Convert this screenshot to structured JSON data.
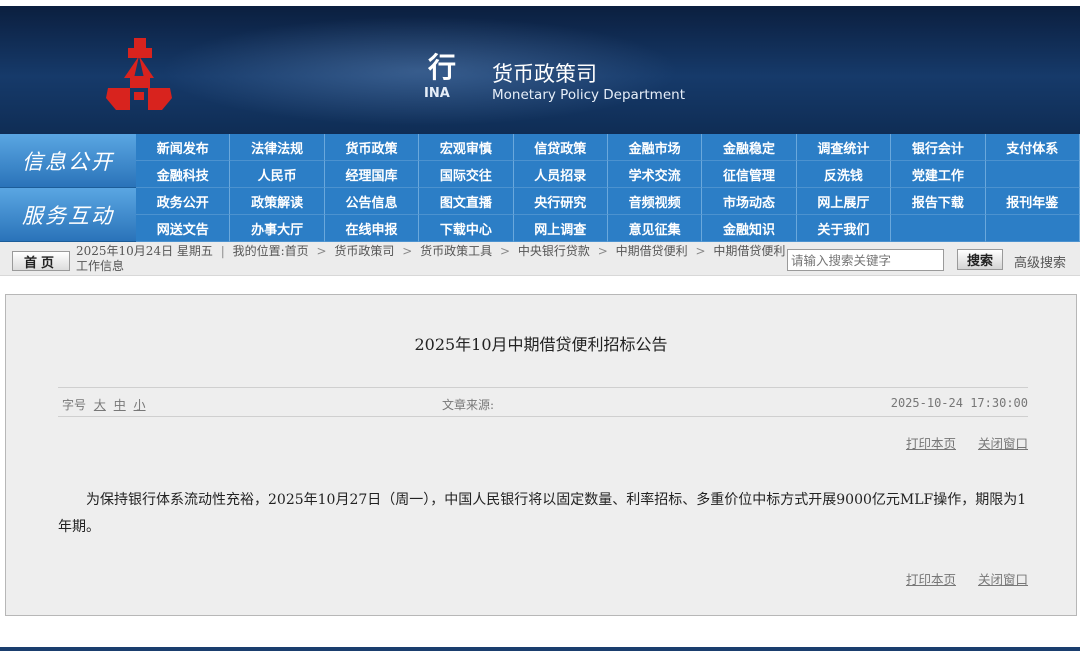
{
  "header": {
    "bank_char": "行",
    "bank_en": "INA",
    "dept_cn": "货币政策司",
    "dept_en": "Monetary Policy Department"
  },
  "nav": {
    "label_1": "信息公开",
    "label_2": "服务互动",
    "rows": [
      [
        "新闻发布",
        "法律法规",
        "货币政策",
        "宏观审慎",
        "信贷政策",
        "金融市场",
        "金融稳定",
        "调查统计",
        "银行会计",
        "支付体系"
      ],
      [
        "金融科技",
        "人民币",
        "经理国库",
        "国际交往",
        "人员招录",
        "学术交流",
        "征信管理",
        "反洗钱",
        "党建工作",
        ""
      ],
      [
        "政务公开",
        "政策解读",
        "公告信息",
        "图文直播",
        "央行研究",
        "音频视频",
        "市场动态",
        "网上展厅",
        "报告下载",
        "报刊年鉴"
      ],
      [
        "网送文告",
        "办事大厅",
        "在线申报",
        "下载中心",
        "网上调查",
        "意见征集",
        "金融知识",
        "关于我们",
        "",
        ""
      ]
    ]
  },
  "bar": {
    "home": "首页",
    "date": "2025年10月24日 星期五",
    "location_label": "我的位置:",
    "crumbs": [
      "首页",
      "货币政策司",
      "货币政策工具",
      "中央银行贷款",
      "中期借贷便利",
      "中期借贷便利工作信息"
    ],
    "search_placeholder": "请输入搜索关键字",
    "search_btn": "搜索",
    "advanced": "高级搜索"
  },
  "article": {
    "title": "2025年10月中期借贷便利招标公告",
    "font_label": "字号",
    "font_large": "大",
    "font_mid": "中",
    "font_small": "小",
    "source_label": "文章来源:",
    "datetime": "2025-10-24 17:30:00",
    "print": "打印本页",
    "close": "关闭窗口",
    "body": "为保持银行体系流动性充裕，2025年10月27日（周一），中国人民银行将以固定数量、利率招标、多重价位中标方式开展9000亿元MLF操作，期限为1年期。"
  }
}
